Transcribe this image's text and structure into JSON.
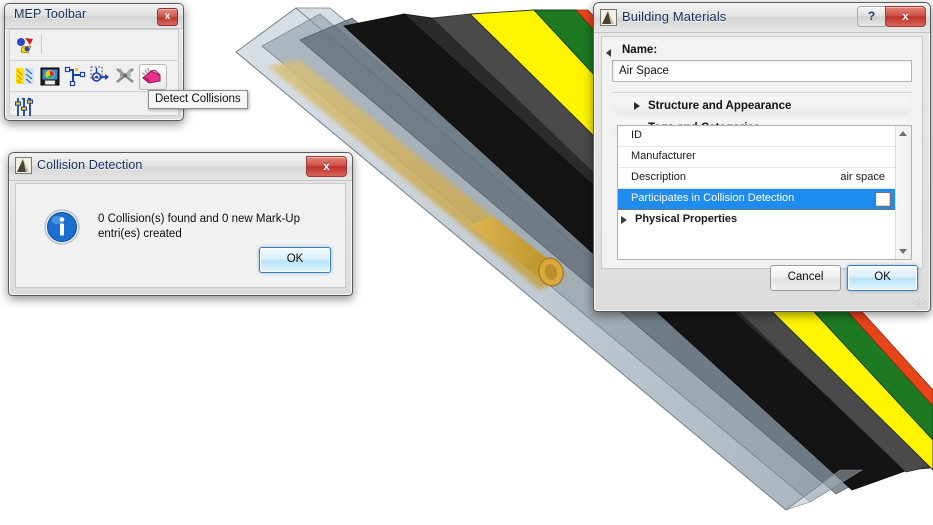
{
  "mep_toolbar": {
    "title": "MEP Toolbar",
    "close_label": "x",
    "icons_row1": [
      {
        "name": "mep-modeler-icon",
        "label": "MEP Modeler"
      }
    ],
    "icons_row2": [
      {
        "name": "mep-preferences-icon",
        "label": "MEP Preferences"
      },
      {
        "name": "mep-edit-routing-icon",
        "label": "Edit Routing"
      },
      {
        "name": "route-elements-icon",
        "label": "Route Elements"
      },
      {
        "name": "connect-elements-icon",
        "label": "Connect Elements"
      },
      {
        "name": "mep-tools-icon",
        "label": "MEP Tools"
      },
      {
        "name": "detect-collisions-icon",
        "label": "Detect Collisions"
      }
    ],
    "icons_row3": [
      {
        "name": "mep-settings-icon",
        "label": "MEP System Settings"
      }
    ],
    "tooltip": "Detect Collisions"
  },
  "collision_dialog": {
    "title": "Collision Detection",
    "icon": "archicad-icon",
    "close_label": "x",
    "message": "0 Collision(s) found and 0 new Mark-Up entri(es) created",
    "info_icon": "info-icon",
    "ok_label": "OK"
  },
  "building_materials_dialog": {
    "title": "Building Materials",
    "icon": "archicad-icon",
    "help_label": "?",
    "close_label": "x",
    "name_label": "Name:",
    "name_value": "Air Space",
    "sections": [
      {
        "label": "Structure and Appearance",
        "expanded": false
      },
      {
        "label": "Tags and Categories",
        "expanded": true
      }
    ],
    "grid_rows": [
      {
        "key": "ID",
        "value": "",
        "selected": false,
        "type": "row"
      },
      {
        "key": "Manufacturer",
        "value": "",
        "selected": false,
        "type": "row"
      },
      {
        "key": "Description",
        "value": "air space",
        "selected": false,
        "type": "row"
      },
      {
        "key": "Participates in Collision Detection",
        "value": "",
        "selected": true,
        "type": "checkbox",
        "checked": false
      },
      {
        "key": "Physical Properties",
        "value": "",
        "selected": false,
        "type": "section"
      }
    ],
    "cancel_label": "Cancel",
    "ok_label": "OK",
    "colors": {
      "selection_blue": "#1f8cf0",
      "default_button_border": "#3c7fb1",
      "close_red": "#bc332d",
      "title_text": "#10305e"
    }
  },
  "model_view": {
    "description": "3D isometric cutaway of a multi-layer composite wall with an MEP duct passing through",
    "layers": [
      {
        "name": "glass-outer-layer",
        "color": "#b7c2cb"
      },
      {
        "name": "air-space-layer",
        "color": "#5d6872"
      },
      {
        "name": "dark-core-layer",
        "color": "#1a1a1a"
      },
      {
        "name": "grey-layer",
        "color": "#4d4d4d"
      },
      {
        "name": "yellow-insulation-layer",
        "color": "#fdf400"
      },
      {
        "name": "green-layer",
        "color": "#1d7a23"
      },
      {
        "name": "red-finish-layer",
        "color": "#e8441a"
      }
    ],
    "duct_color": "#c39b3c"
  }
}
